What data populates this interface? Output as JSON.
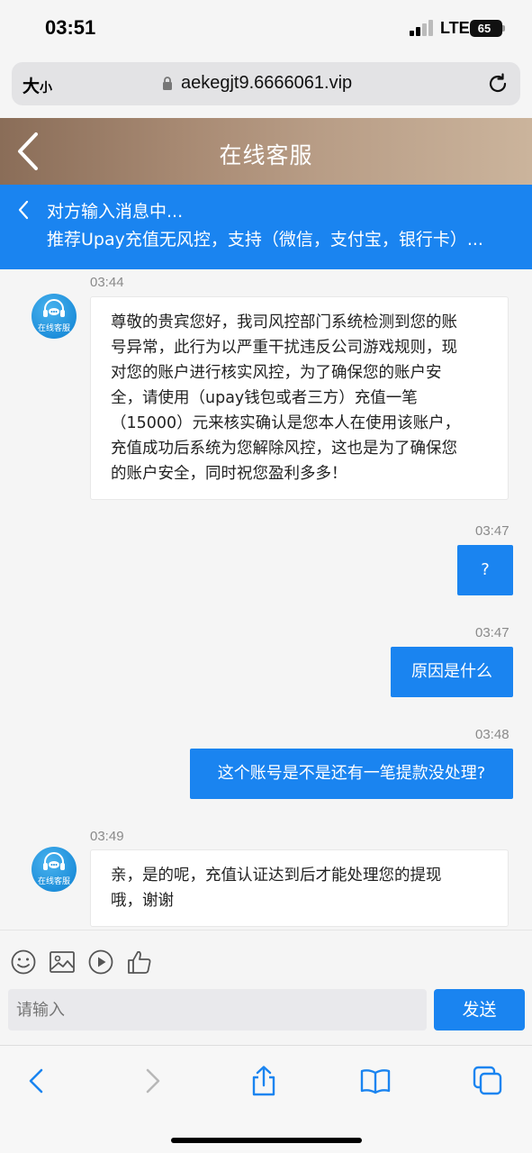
{
  "status_bar": {
    "time": "03:51",
    "network": "LTE",
    "battery": "65"
  },
  "browser": {
    "text_size_label_big": "大",
    "text_size_label_small": "小",
    "url": "aekegjt9.6666061.vip"
  },
  "header": {
    "title": "在线客服"
  },
  "notice": {
    "typing": "对方输入消息中...",
    "promo": "推荐Upay充值无风控，支持（微信，支付宝，银行卡）..."
  },
  "agent": {
    "avatar_label": "在线客服"
  },
  "messages": [
    {
      "time": "03:44",
      "from": "agent",
      "lines": [
        "尊敬的贵宾您好，我司风控部门系统检测到您的账",
        "号异常，此行为以严重干扰违反公司游戏规则，现",
        "对您的账户进行核实风控，为了确保您的账户安",
        "全，请使用（upay钱包或者三方）充值一笔",
        "（15000）元来核实确认是您本人在使用该账户，",
        "充值成功后系统为您解除风控，这也是为了确保您",
        "的账户安全，同时祝您盈利多多！"
      ]
    },
    {
      "time": "03:47",
      "from": "user",
      "text": "?"
    },
    {
      "time": "03:47",
      "from": "user",
      "text": "原因是什么"
    },
    {
      "time": "03:48",
      "from": "user",
      "text": "这个账号是不是还有一笔提款没处理?"
    },
    {
      "time": "03:49",
      "from": "agent",
      "lines": [
        "亲，是的呢，充值认证达到后才能处理您的提现",
        "哦，谢谢"
      ]
    }
  ],
  "composer": {
    "placeholder": "请输入",
    "send_label": "发送"
  },
  "icons": {
    "emoji": "smiley-icon",
    "image": "image-icon",
    "video": "play-icon",
    "like": "thumbs-up-icon"
  },
  "colors": {
    "accent": "#1a84f0",
    "header_bg": "#a88a73"
  }
}
